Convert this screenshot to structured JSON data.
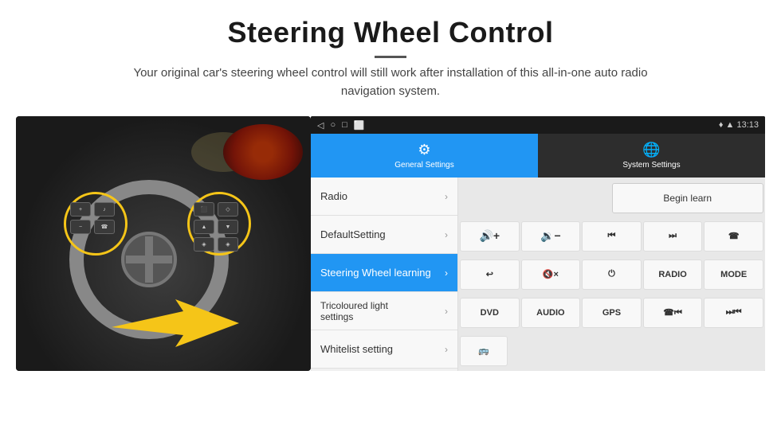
{
  "header": {
    "title": "Steering Wheel Control",
    "subtitle": "Your original car's steering wheel control will still work after installation of this all-in-one auto radio navigation system."
  },
  "status_bar": {
    "wifi_icon": "wifi",
    "signal_icon": "signal",
    "time": "13:13",
    "location_icon": "location"
  },
  "tabs": [
    {
      "id": "general",
      "label": "General Settings",
      "active": true
    },
    {
      "id": "system",
      "label": "System Settings",
      "active": false
    }
  ],
  "menu_items": [
    {
      "id": "radio",
      "label": "Radio",
      "active": false
    },
    {
      "id": "default",
      "label": "DefaultSetting",
      "active": false
    },
    {
      "id": "steering",
      "label": "Steering Wheel learning",
      "active": true
    },
    {
      "id": "tricoloured",
      "label": "Tricoloured light settings",
      "active": false
    },
    {
      "id": "whitelist",
      "label": "Whitelist setting",
      "active": false
    }
  ],
  "controls": {
    "begin_learn": "Begin learn",
    "buttons": [
      [
        "vol_up",
        "vol_down",
        "prev",
        "next",
        "phone"
      ],
      [
        "back",
        "mute_x",
        "power",
        "RADIO",
        "MODE"
      ],
      [
        "DVD",
        "AUDIO",
        "GPS",
        "phone_prev",
        "next_prev"
      ],
      [
        "list_icon"
      ]
    ]
  }
}
